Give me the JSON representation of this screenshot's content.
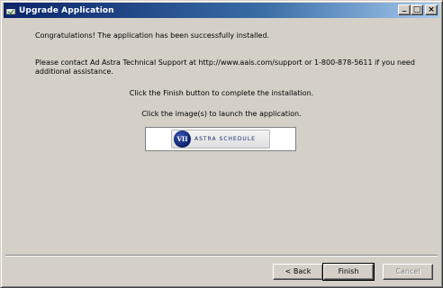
{
  "window": {
    "title": "Upgrade Application",
    "minimize_glyph": "_",
    "maximize_glyph": "□",
    "close_glyph": "×"
  },
  "messages": {
    "congrats": "Congratulations!  The application has been successfully installed.",
    "support_line1": "Please contact Ad Astra Technical Support at http://www.aais.com/support or 1-800-878-5611 if you need",
    "support_line2": "additional assistance.",
    "finish_hint": "Click the Finish button to complete the installation.",
    "launch_hint": "Click the image(s) to launch the application."
  },
  "launch_image": {
    "logo_text": "VII",
    "product_label": "ASTRA SCHEDULE"
  },
  "buttons": {
    "back": "< Back",
    "finish": "Finish",
    "cancel": "Cancel"
  },
  "colors": {
    "titlebar_start": "#0a246a",
    "titlebar_end": "#a6caf0",
    "window_bg": "#d4d0c8"
  }
}
